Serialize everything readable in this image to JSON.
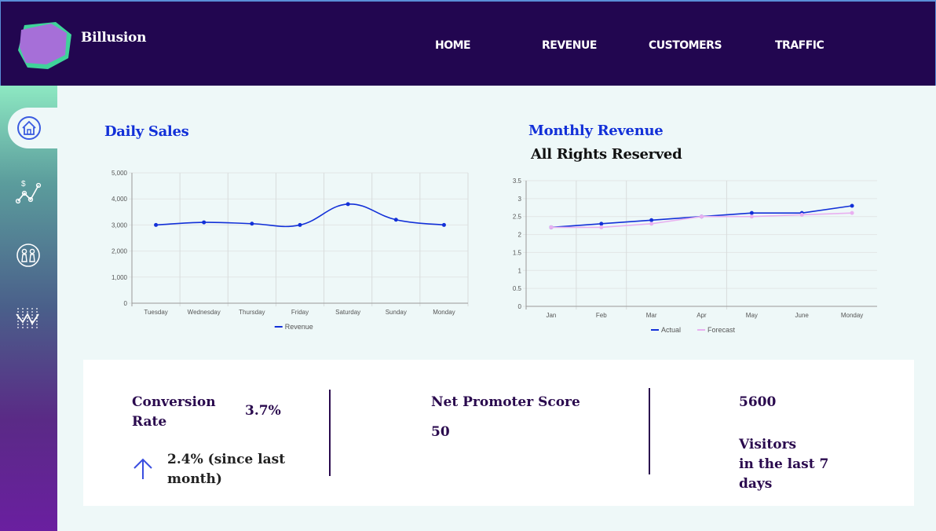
{
  "app": {
    "brand": "Billusion"
  },
  "nav": {
    "items": [
      "HOME",
      "REVENUE",
      "CUSTOMERS",
      "TRAFFIC"
    ]
  },
  "sidebar": {
    "items": [
      "home-icon",
      "revenue-chart-icon",
      "customers-icon",
      "traffic-icon"
    ],
    "active": 0
  },
  "colors": {
    "header": "#220650",
    "accent_blue": "#1230d8",
    "forecast_pink": "#e8b0f0",
    "text_dark": "#2a0a4e",
    "content_bg": "#eef8f8"
  },
  "charts": {
    "daily": {
      "title": "Daily Sales"
    },
    "monthly": {
      "title": "Monthly Revenue",
      "subtitle": "All Rights Reserved"
    }
  },
  "chart_data": [
    {
      "type": "line",
      "categories": [
        "Tuesday",
        "Wednesday",
        "Thursday",
        "Friday",
        "Saturday",
        "Sunday",
        "Monday"
      ],
      "series": [
        {
          "name": "Revenue",
          "values": [
            3000,
            3100,
            3050,
            3000,
            3800,
            3200,
            3000
          ],
          "color": "#1230d8"
        }
      ],
      "yticks": [
        "0",
        "1,000",
        "2,000",
        "3,000",
        "4,000",
        "5,000"
      ],
      "ylim": [
        0,
        5000
      ],
      "smooth": true,
      "grid": true,
      "legend": "bottom"
    },
    {
      "type": "line",
      "categories": [
        "Jan",
        "Feb",
        "Mar",
        "Apr",
        "May",
        "June",
        "Monday"
      ],
      "series": [
        {
          "name": "Actual",
          "values": [
            2.2,
            2.3,
            2.4,
            2.5,
            2.6,
            2.6,
            2.8
          ],
          "color": "#1230d8"
        },
        {
          "name": "Forecast",
          "values": [
            2.2,
            2.2,
            2.3,
            2.5,
            2.5,
            2.55,
            2.6
          ],
          "color": "#e8b0f0"
        }
      ],
      "yticks": [
        "0",
        "0.5",
        "1",
        "1.5",
        "2",
        "2.5",
        "3",
        "3.5"
      ],
      "ylim": [
        0,
        3.5
      ],
      "grid": true,
      "legend": "bottom"
    }
  ],
  "stats": {
    "conversion": {
      "label_line1": "Conversion",
      "label_line2": "Rate",
      "value": "3.7%",
      "change_line1": "2.4% (since last",
      "change_line2": "month)",
      "icon": "arrow-up-icon"
    },
    "nps": {
      "label": "Net Promoter Score",
      "value": "50"
    },
    "visitors": {
      "value": "5600",
      "line1": "Visitors",
      "line2": "in the last 7",
      "line3": "days"
    }
  }
}
